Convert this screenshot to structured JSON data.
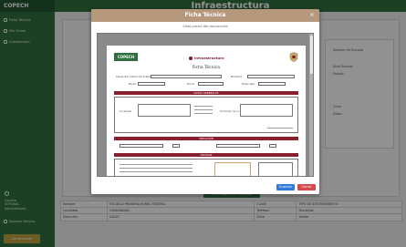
{
  "app": {
    "logo": "COPECH",
    "title": "Infraestructura"
  },
  "sidebar": {
    "items": [
      {
        "label": "Ficha Técnica",
        "icon": "file-icon"
      },
      {
        "label": "Mis Fichas",
        "icon": "folder-icon"
      },
      {
        "label": "Cuestionario",
        "icon": "list-icon"
      }
    ],
    "user_lines": [
      "Usuario",
      "SOTOBAL",
      "Administrador"
    ],
    "support_label": "Soporte técnico",
    "logout_label": "Cerrar sesión"
  },
  "background": {
    "button_label": "Ver Imagen PDF Completa",
    "right_labels": [
      "Nombre de Escuela",
      "Nivel Escolar",
      "Estado",
      "Turno",
      "Datos"
    ],
    "table": [
      [
        "Nombre",
        "ESCUELA PRIMARIA RURAL FEDERAL",
        "CLAVE",
        "TIPO DE SOSTENIMIENTO"
      ],
      [
        "Localidad",
        "COMUNIDAD",
        "Teléfono",
        "Municipio"
      ],
      [
        "Dirección",
        "CALLE",
        "Zona",
        "Sector"
      ]
    ]
  },
  "modal": {
    "title": "Ficha Técnica",
    "subtitle": "Vista previa del documento",
    "close_label": "×",
    "primary_label": "Guardar",
    "secondary_label": "Cerrar"
  },
  "pdf": {
    "logo": "COPECH",
    "org_name": "Infraestructura",
    "title": "Ficha Técnica",
    "band1": "DATOS GENERALES",
    "band2": "UBICACIÓN",
    "band3": "CROQUIS",
    "field_labels": [
      "Clave del centro de trabajo",
      "Nombre",
      "Nivel",
      "Turno",
      "Municipio",
      "Localidad"
    ],
    "note": "Domicilio de la escuela"
  },
  "colors": {
    "primary_green": "#2f6e3e",
    "modal_header": "#b6987d",
    "band_red": "#8a1f2f",
    "button_blue": "#2f7bd6",
    "button_red": "#d84a4a"
  }
}
